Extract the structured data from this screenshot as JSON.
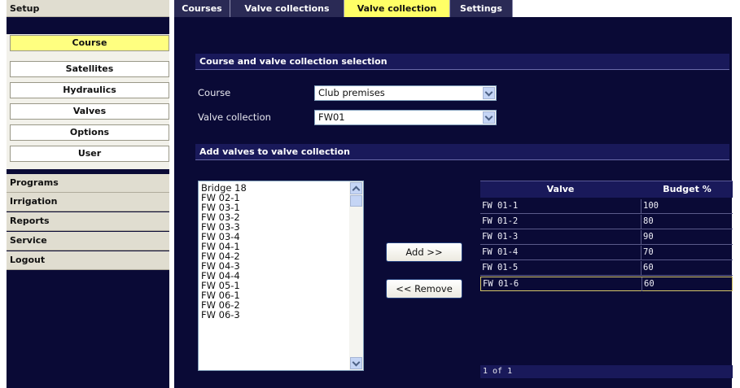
{
  "sidebar": {
    "header": "Setup",
    "subitems": [
      {
        "label": "Course",
        "active": true
      },
      {
        "label": "Satellites"
      },
      {
        "label": "Hydraulics"
      },
      {
        "label": "Valves"
      },
      {
        "label": "Options"
      },
      {
        "label": "User"
      }
    ],
    "items": [
      {
        "label": "Programs"
      },
      {
        "label": "Irrigation"
      },
      {
        "label": "Reports"
      },
      {
        "label": "Service"
      },
      {
        "label": "Logout"
      }
    ]
  },
  "tabs": [
    {
      "label": "Courses"
    },
    {
      "label": "Valve collections"
    },
    {
      "label": "Valve collection",
      "active": true
    },
    {
      "label": "Settings"
    }
  ],
  "selection_section": {
    "title": "Course and valve collection selection",
    "course_label": "Course",
    "course_value": "Club premises",
    "collection_label": "Valve collection",
    "collection_value": "FW01"
  },
  "add_section": {
    "title": "Add valves to valve collection",
    "available_valves": [
      "Bridge 18",
      "FW 02-1",
      "FW 03-1",
      "FW 03-2",
      "FW 03-3",
      "FW 03-4",
      "FW 04-1",
      "FW 04-2",
      "FW 04-3",
      "FW 04-4",
      "FW 05-1",
      "FW 06-1",
      "FW 06-2",
      "FW 06-3"
    ],
    "add_button": "Add >>",
    "remove_button": "<< Remove"
  },
  "table": {
    "headers": [
      "Valve",
      "Budget %"
    ],
    "rows": [
      {
        "valve": "FW 01-1",
        "budget": "100"
      },
      {
        "valve": "FW 01-2",
        "budget": "80"
      },
      {
        "valve": "FW 01-3",
        "budget": "90"
      },
      {
        "valve": "FW 01-4",
        "budget": "70"
      },
      {
        "valve": "FW 01-5",
        "budget": "60"
      },
      {
        "valve": "FW 01-6",
        "budget": "60",
        "selected": true
      }
    ],
    "pager": "1 of 1"
  },
  "colors": {
    "panel_bg": "#0a0a36",
    "section_bg": "#19195a",
    "active_tab": "#ffff66",
    "active_subitem": "#ffff80"
  }
}
